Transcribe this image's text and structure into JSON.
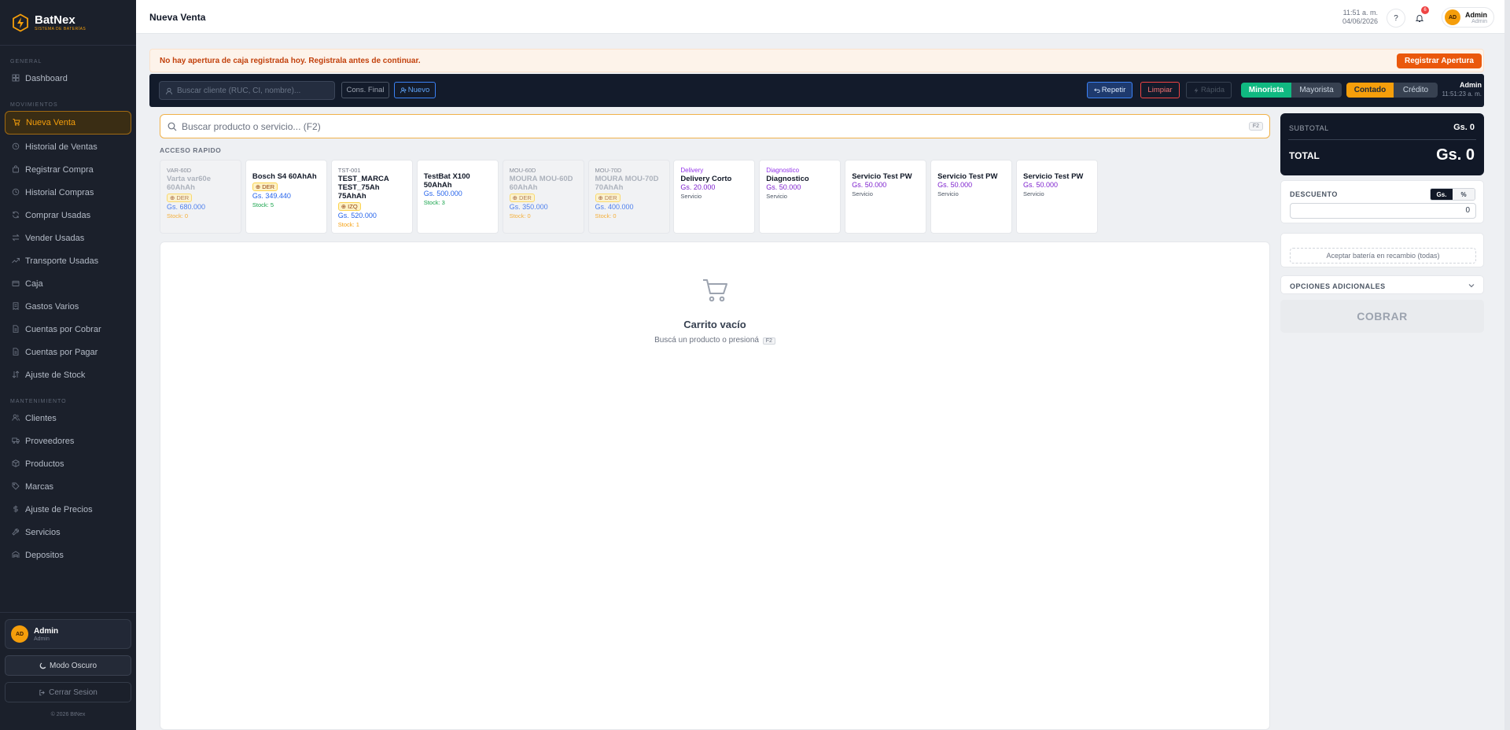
{
  "brand": {
    "name": "BatNex",
    "tagline": "SISTEMA DE BATERÍAS",
    "logo_icon": "bolt-hexagon-icon",
    "accent": "#f59e0b"
  },
  "sidebar": {
    "sections": [
      {
        "title": "GENERAL",
        "items": [
          {
            "label": "Dashboard",
            "icon": "dashboard-icon"
          }
        ]
      },
      {
        "title": "MOVIMIENTOS",
        "items": [
          {
            "label": "Nueva Venta",
            "icon": "cart-icon",
            "active": true
          },
          {
            "label": "Historial de Ventas",
            "icon": "history-icon"
          },
          {
            "label": "Registrar Compra",
            "icon": "bag-icon"
          },
          {
            "label": "Historial Compras",
            "icon": "history-icon"
          },
          {
            "label": "Comprar Usadas",
            "icon": "refresh-icon"
          },
          {
            "label": "Vender Usadas",
            "icon": "swap-icon"
          },
          {
            "label": "Transporte Usadas",
            "icon": "trend-icon"
          },
          {
            "label": "Caja",
            "icon": "cash-icon"
          },
          {
            "label": "Gastos Varios",
            "icon": "receipt-icon"
          },
          {
            "label": "Cuentas por Cobrar",
            "icon": "document-icon"
          },
          {
            "label": "Cuentas por Pagar",
            "icon": "document-icon"
          },
          {
            "label": "Ajuste de Stock",
            "icon": "sort-icon"
          }
        ]
      },
      {
        "title": "MANTENIMIENTO",
        "items": [
          {
            "label": "Clientes",
            "icon": "users-icon"
          },
          {
            "label": "Proveedores",
            "icon": "truck-icon"
          },
          {
            "label": "Productos",
            "icon": "box-icon"
          },
          {
            "label": "Marcas",
            "icon": "tag-icon"
          },
          {
            "label": "Ajuste de Precios",
            "icon": "dollar-icon"
          },
          {
            "label": "Servicios",
            "icon": "wrench-icon"
          },
          {
            "label": "Depositos",
            "icon": "warehouse-icon"
          }
        ]
      }
    ],
    "user": {
      "initials": "AD",
      "name": "Admin",
      "role": "Admin"
    },
    "dark_mode_label": "Modo Oscuro",
    "logout_label": "Cerrar Sesion",
    "copyright": "© 2026 BtNex"
  },
  "header": {
    "title": "Nueva Venta",
    "time": "11:51 a. m.",
    "date": "04/06/2026",
    "help_label": "?",
    "notif_count": "6",
    "user": {
      "initials": "AD",
      "name": "Admin",
      "role": "Admin"
    }
  },
  "alert": {
    "message": "No hay apertura de caja registrada hoy. Registrala antes de continuar.",
    "button": "Registrar Apertura"
  },
  "toolbar": {
    "client_placeholder": "Buscar cliente (RUC, CI, nombre)...",
    "cons_final": "Cons. Final",
    "nuevo": "Nuevo",
    "repetir": "Repetir",
    "limpiar": "Limpiar",
    "rapida": "Rápida",
    "price_types": [
      "Minorista",
      "Mayorista"
    ],
    "price_type_selected": "Minorista",
    "pay_types": [
      "Contado",
      "Crédito"
    ],
    "pay_type_selected": "Contado",
    "user": "Admin",
    "time": "11:51:23 a. m."
  },
  "product_search": {
    "placeholder": "Buscar producto o servicio... (F2)",
    "shortcut": "F2"
  },
  "quick_access": {
    "title": "ACCESO RAPIDO",
    "items": [
      {
        "code": "VAR-60D",
        "name": "Varta var60e 60AhAh",
        "tag": "DER",
        "price": "Gs. 680.000",
        "stock": "Stock: 0",
        "disabled": true
      },
      {
        "name": "Bosch S4 60AhAh",
        "tag": "DER",
        "price": "Gs. 349.440",
        "stock": "Stock: 5"
      },
      {
        "code": "TST-001",
        "name": "TEST_MARCA TEST_75Ah 75AhAh",
        "tag": "IZQ",
        "price": "Gs. 520.000",
        "stock": "Stock: 1"
      },
      {
        "name": "TestBat X100 50AhAh",
        "price": "Gs. 500.000",
        "stock": "Stock: 3"
      },
      {
        "code": "MOU-60D",
        "name": "MOURA MOU-60D 60AhAh",
        "tag": "DER",
        "price": "Gs. 350.000",
        "stock": "Stock: 0",
        "disabled": true
      },
      {
        "code": "MOU-70D",
        "name": "MOURA MOU-70D 70AhAh",
        "tag": "DER",
        "price": "Gs. 400.000",
        "stock": "Stock: 0",
        "disabled": true
      },
      {
        "category": "Delivery",
        "name": "Delivery Corto",
        "price": "Gs. 20.000",
        "kind": "Servicio"
      },
      {
        "category": "Diagnostico",
        "name": "Diagnostico",
        "price": "Gs. 50.000",
        "kind": "Servicio"
      },
      {
        "name": "Servicio Test PW",
        "price": "Gs. 50.000",
        "kind": "Servicio"
      },
      {
        "name": "Servicio Test PW",
        "price": "Gs. 50.000",
        "kind": "Servicio"
      },
      {
        "name": "Servicio Test PW",
        "price": "Gs. 50.000",
        "kind": "Servicio"
      }
    ]
  },
  "cart": {
    "empty_title": "Carrito vacío",
    "empty_hint": "Buscá un producto o presioná",
    "hint_key": "F2"
  },
  "summary": {
    "subtotal_label": "SUBTOTAL",
    "subtotal": "Gs. 0",
    "total_label": "TOTAL",
    "total": "Gs. 0"
  },
  "discount": {
    "label": "DESCUENTO",
    "modes": [
      "Gs.",
      "%"
    ],
    "mode_selected": "Gs.",
    "value": "0"
  },
  "trade_in": {
    "label": "Aceptar batería en recambio (todas)"
  },
  "extra": {
    "label": "OPCIONES ADICIONALES"
  },
  "checkout": {
    "label": "COBRAR"
  }
}
